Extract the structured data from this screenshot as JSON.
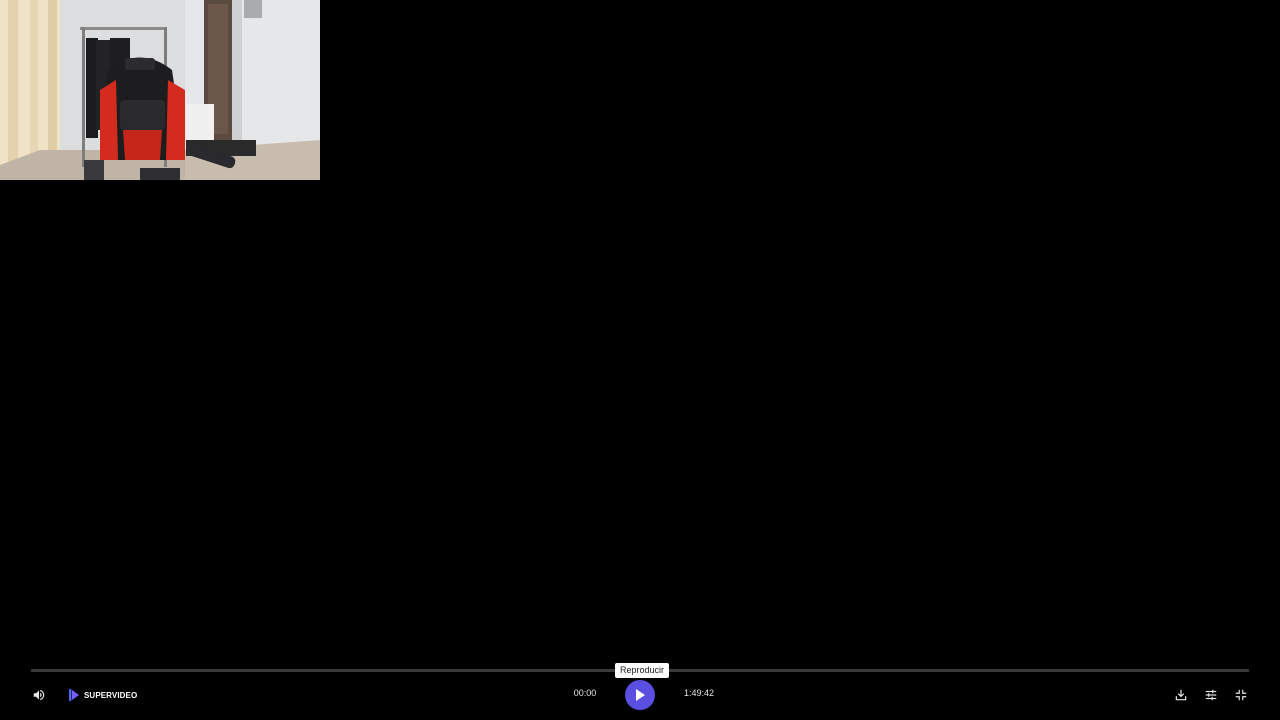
{
  "player": {
    "brand_name": "SUPERVIDEO",
    "tooltip": "Reproducir",
    "time_current": "00:00",
    "time_total": "1:49:42",
    "progress": 0
  },
  "icons": {
    "volume": "volume-icon",
    "play": "play-icon",
    "download": "download-icon",
    "settings": "settings-icon",
    "fullscreen": "exit-fullscreen-icon",
    "logo": "supervideo-logo-icon"
  },
  "colors": {
    "accent": "#5a4fe0",
    "background": "#000000",
    "track": "#3a3a3a",
    "text": "#e6e6e6"
  }
}
